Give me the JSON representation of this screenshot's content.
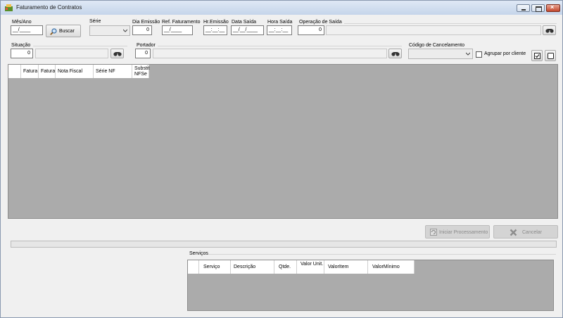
{
  "window": {
    "title": "Faturamento de Contratos"
  },
  "filters": {
    "mes_ano": {
      "label": "Mês/Ano",
      "value": "__/____"
    },
    "buscar_label": "Buscar",
    "serie": {
      "label": "Série",
      "value": ""
    },
    "dia_emissao": {
      "label": "Dia Emissão",
      "value": "0"
    },
    "ref_faturamento": {
      "label": "Ref. Faturamento",
      "value": "__/____"
    },
    "hr_emissao": {
      "label": "Hr.Emissão",
      "value": "__:__:__"
    },
    "data_saida": {
      "label": "Data Saída",
      "value": "__/__/____"
    },
    "hora_saida": {
      "label": "Hora Saída",
      "value": "__:__:__"
    },
    "operacao_saida": {
      "label": "Operação de Saída",
      "value": "0",
      "description": ""
    },
    "situacao": {
      "label": "Situação",
      "value": "0",
      "description": ""
    },
    "portador": {
      "label": "Portador",
      "value": "0",
      "description": ""
    },
    "codigo_cancelamento": {
      "label": "Código de Cancelamento",
      "value": ""
    },
    "agrupar_label": "Agrupar por cliente"
  },
  "main_grid": {
    "columns": [
      "Fatura",
      "Fatura",
      "Nota Fiscal",
      "Série NF",
      "Substit NFSe"
    ]
  },
  "actions": {
    "iniciar_label": "Iniciar Processamento",
    "cancelar_label": "Cancelar"
  },
  "servicos": {
    "title": "Serviços",
    "columns": [
      "Serviço",
      "Descrição",
      "Qtde.",
      "Valor Unit.",
      "ValorItem",
      "ValorMínimo"
    ]
  },
  "icons": {
    "app": "app-icon",
    "search": "search-icon",
    "lookup": "binoculars-icon",
    "process": "refresh-icon",
    "cancel": "x-icon",
    "check_all": "check-all-icon",
    "uncheck_all": "uncheck-all-icon"
  }
}
